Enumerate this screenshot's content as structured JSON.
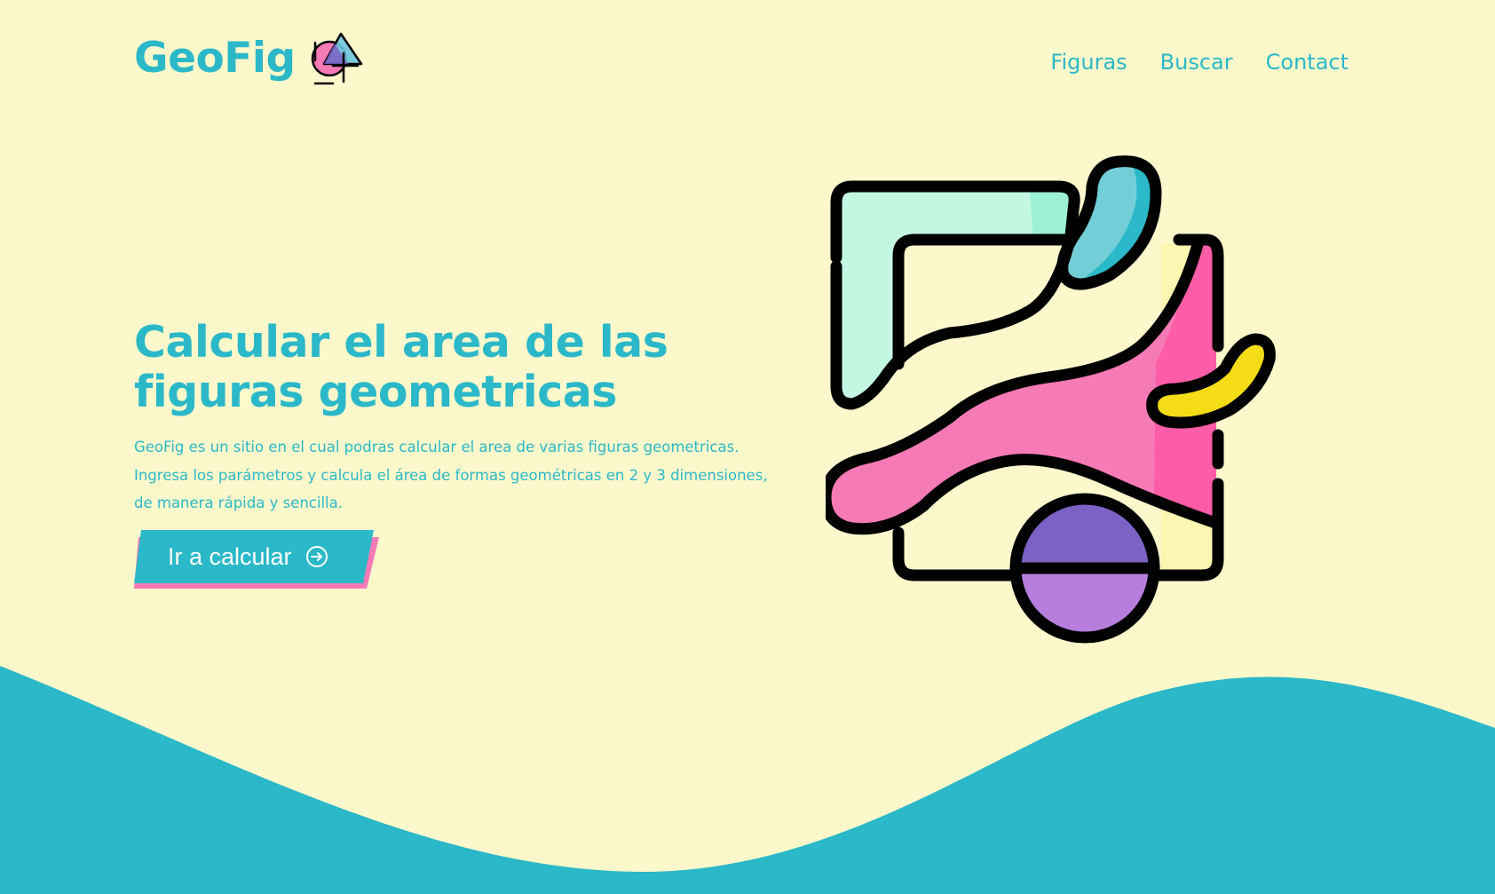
{
  "brand": {
    "name": "GeoFig",
    "logo_icon": "geometric-shapes-logo-icon"
  },
  "nav": {
    "items": [
      {
        "label": "Figuras"
      },
      {
        "label": "Buscar"
      },
      {
        "label": "Contact"
      }
    ]
  },
  "hero": {
    "title_line1": "Calcular el area de las",
    "title_line2": "figuras geometricas",
    "desc_line1": "GeoFig es un sitio en el cual podras calcular el area de varias figuras geometricas.",
    "desc_line2": "Ingresa los parámetros y calcula el área de formas geométricas en 2 y 3 dimensiones,",
    "desc_line3": "de manera rápida y sencilla.",
    "cta_label": "Ir a calcular",
    "cta_icon": "arrow-circle-right-icon"
  },
  "colors": {
    "background": "#fdf8cc",
    "accent": "#2bb8c8",
    "pink": "#f57ab6",
    "purple": "#7b62c4",
    "yellow": "#f4dc16",
    "mint": "#c4f7e2"
  }
}
